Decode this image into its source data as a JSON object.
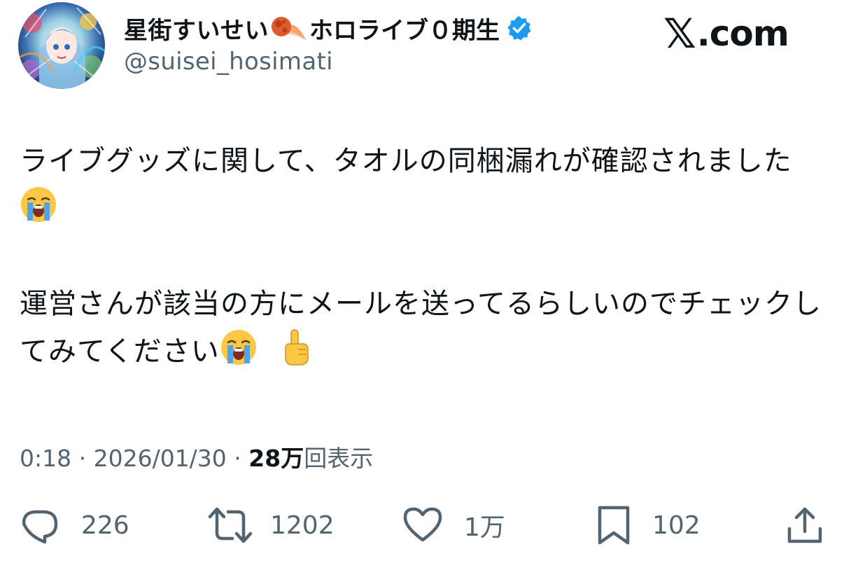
{
  "header": {
    "display_name": "星街すいせい",
    "name_suffix": "ホロライブ０期生",
    "handle": "@suisei_hosimati",
    "brand": ".com",
    "brand_x": "𝕏",
    "name_emoji": "comet-icon",
    "verified_color": "#1d9bf0"
  },
  "body": {
    "para1_text": "ライブグッズに関して、タオルの同梱漏れが確認されました",
    "para2_text": "運営さんが該当の方にメールを送ってるらしいのでチェックしてみてください",
    "para1_emoji": "crying-face-icon",
    "para2_emojis": [
      "crying-face-icon",
      "pointing-up-icon"
    ]
  },
  "meta": {
    "time": "0:18",
    "sep": " · ",
    "date": "2026/01/30",
    "views_count": "28万",
    "views_label": "回表示"
  },
  "actions": {
    "replies": "226",
    "reposts": "1202",
    "likes": "1万",
    "bookmarks": "102"
  },
  "colors": {
    "text": "#0f1419",
    "secondary": "#536471",
    "accent": "#1d9bf0"
  }
}
